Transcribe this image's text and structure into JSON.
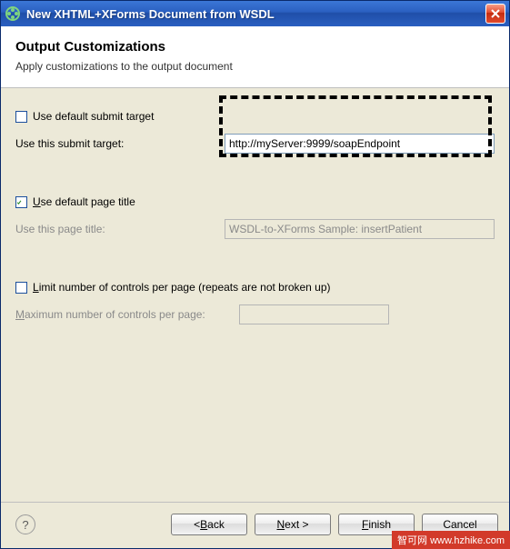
{
  "window": {
    "title": "New XHTML+XForms Document from WSDL"
  },
  "header": {
    "heading": "Output Customizations",
    "description": "Apply customizations to the output document"
  },
  "submit": {
    "use_default_label": "Use default submit target",
    "use_default_checked": false,
    "target_label": "Use this submit target:",
    "target_value": "http://myServer:9999/soapEndpoint"
  },
  "page_title": {
    "use_default_label_pre": "",
    "use_default_label_u": "U",
    "use_default_label_post": "se default page title",
    "use_default_checked": true,
    "custom_label": "Use this page title:",
    "custom_value": "WSDL-to-XForms Sample: insertPatient"
  },
  "limit": {
    "checkbox_label_pre": "",
    "checkbox_label_u": "L",
    "checkbox_label_post": "imit number of controls per page (repeats are not broken up)",
    "checked": false,
    "max_label_pre": "",
    "max_label_u": "M",
    "max_label_post": "aximum number of controls per page:",
    "max_value": ""
  },
  "buttons": {
    "back_pre": "< ",
    "back_u": "B",
    "back_post": "ack",
    "next_u": "N",
    "next_post": "ext >",
    "finish_u": "F",
    "finish_post": "inish",
    "cancel": "Cancel"
  },
  "watermark": "智可网 www.hzhike.com"
}
